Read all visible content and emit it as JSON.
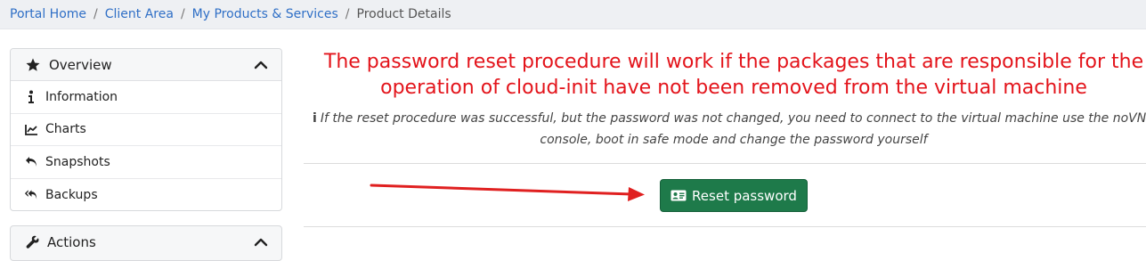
{
  "breadcrumb": {
    "items": [
      "Portal Home",
      "Client Area",
      "My Products & Services"
    ],
    "separator": "/",
    "current": "Product Details"
  },
  "sidebar": {
    "title": "Overview",
    "items": [
      {
        "label": "Information",
        "icon": "info-icon"
      },
      {
        "label": "Charts",
        "icon": "area-chart-icon"
      },
      {
        "label": "Snapshots",
        "icon": "undo-icon"
      },
      {
        "label": "Backups",
        "icon": "undo-all-icon"
      }
    ]
  },
  "sidebar2": {
    "title": "Actions"
  },
  "main": {
    "warning": "The password reset procedure will work if the packages that are responsible for the operation of cloud-init have not been removed from the virtual machine",
    "info_icon": "i",
    "info": "If the reset procedure was successful, but the password was not changed, you need to connect to the virtual machine use the noVNC console, boot in safe mode and change the password yourself",
    "reset_button": "Reset password"
  },
  "colors": {
    "link": "#2f6fc6",
    "warning": "#e3141b",
    "button": "#1e7a4a",
    "arrow": "#e02020"
  }
}
